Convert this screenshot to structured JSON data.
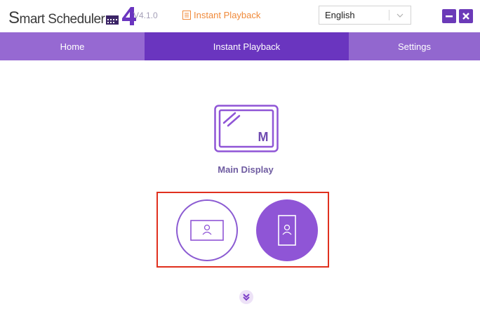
{
  "app": {
    "logo_text_lead": "S",
    "logo_text_rest": "mart Scheduler",
    "logo_number": "4",
    "version": "V4.1.0",
    "mode_label": "Instant Playback"
  },
  "language": {
    "selected": "English"
  },
  "nav": {
    "tabs": [
      {
        "label": "Home",
        "active": false
      },
      {
        "label": "Instant Playback",
        "active": true
      },
      {
        "label": "Settings",
        "active": false
      }
    ]
  },
  "display": {
    "label": "Main Display",
    "badge": "M"
  },
  "orientation": {
    "options": [
      {
        "name": "landscape",
        "selected": false
      },
      {
        "name": "portrait",
        "selected": true
      }
    ]
  },
  "colors": {
    "accent": "#6a35bf",
    "nav_bg": "#9468cf",
    "mode_label": "#f08a3a",
    "highlight": "#e0301e",
    "display_label": "#6f5ca1"
  },
  "icons": {
    "mode": "document-icon",
    "dropdown": "chevron-down-icon",
    "minimize": "minimize-icon",
    "close": "close-icon",
    "display": "monitor-icon",
    "landscape": "landscape-person-icon",
    "portrait": "portrait-person-icon",
    "expand": "double-chevron-down-icon"
  }
}
